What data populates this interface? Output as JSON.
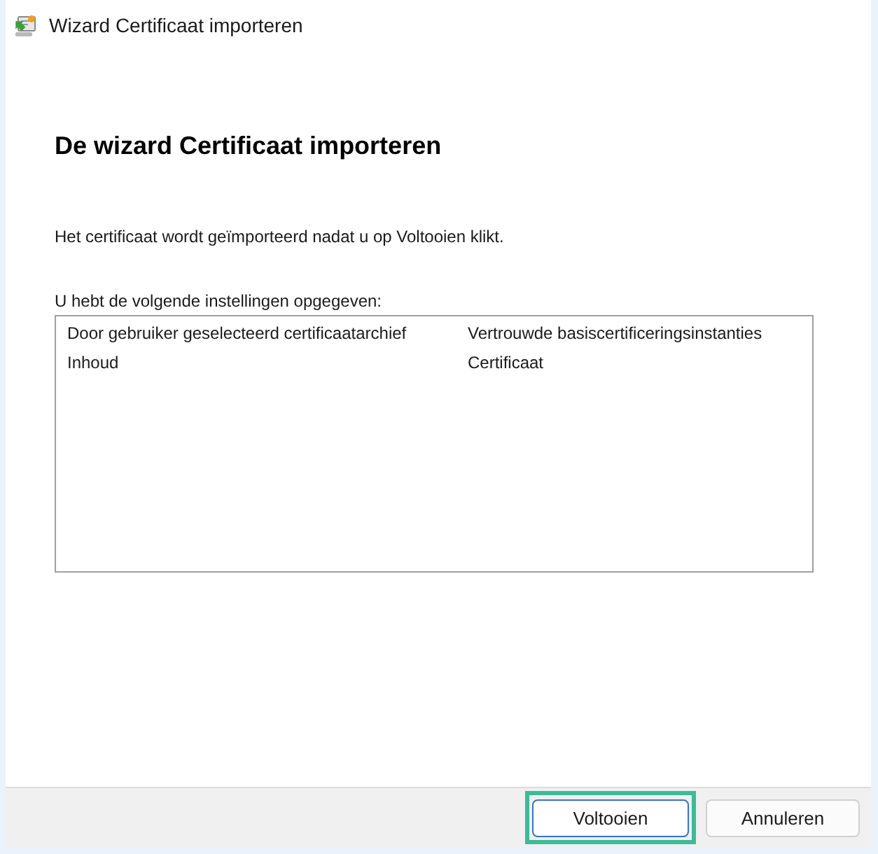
{
  "window": {
    "title": "Wizard Certificaat importeren"
  },
  "heading": "De wizard Certificaat importeren",
  "message": "Het certificaat wordt geïmporteerd nadat u op Voltooien klikt.",
  "settings": {
    "label": "U hebt de volgende instellingen opgegeven:",
    "rows": [
      {
        "name": "Door gebruiker geselecteerd certificaatarchief",
        "value": "Vertrouwde basiscertificeringsinstanties"
      },
      {
        "name": "Inhoud",
        "value": "Certificaat"
      }
    ]
  },
  "buttons": [
    {
      "label": "Voltooien",
      "default": true,
      "highlighted": true
    },
    {
      "label": "Annuleren",
      "default": false,
      "highlighted": false
    }
  ]
}
